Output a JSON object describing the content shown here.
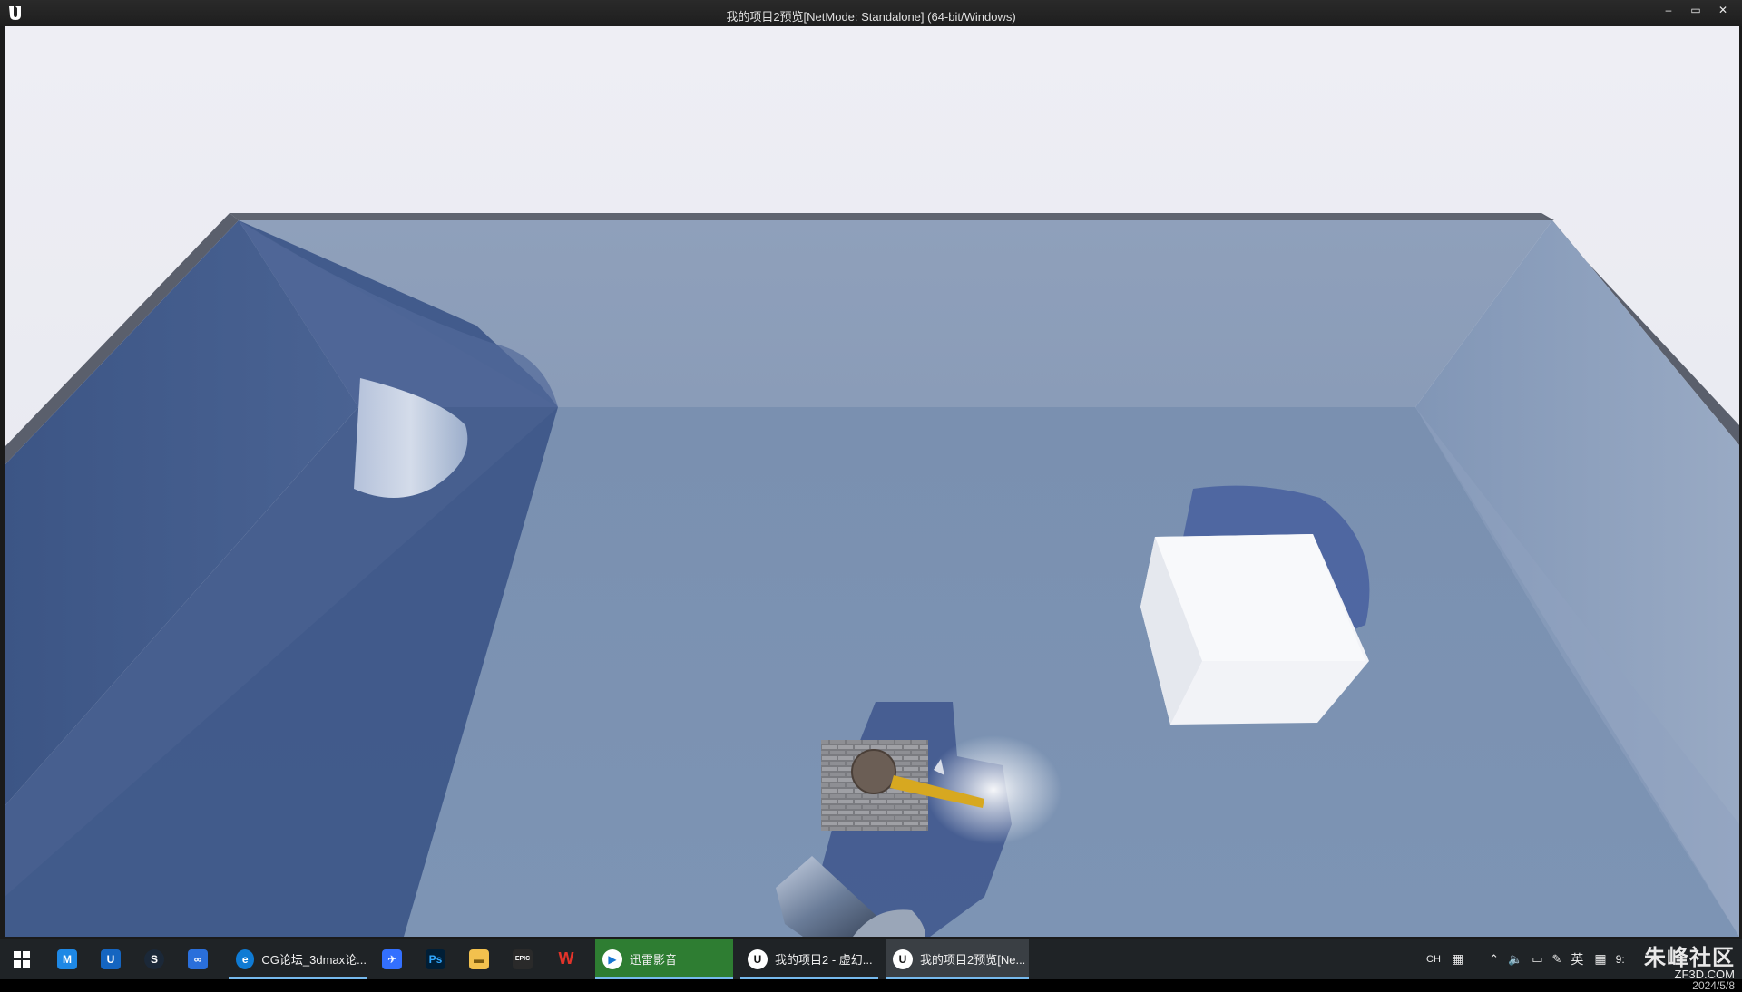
{
  "window": {
    "title": "我的项目2预览[NetMode: Standalone]  (64-bit/Windows)",
    "controls": {
      "minimize": "–",
      "maximize": "▭",
      "close": "✕"
    }
  },
  "taskbar": {
    "start_icon": "windows-start-icon",
    "pinned": [
      {
        "name": "app-blue-m-icon",
        "glyph": "M",
        "color": "#1e88e5"
      },
      {
        "name": "app-u-icon",
        "glyph": "U",
        "color": "#1565c0"
      },
      {
        "name": "steam-icon",
        "glyph": "S",
        "color": "#1b2838"
      },
      {
        "name": "baidu-netdisk-icon",
        "glyph": "∞",
        "color": "#2a6fdb"
      }
    ],
    "tasks": [
      {
        "label": "CG论坛_3dmax论...",
        "icon": "edge-browser-icon",
        "active": true
      },
      {
        "label": "迅雷影音",
        "icon": "xunlei-player-icon",
        "active": true
      },
      {
        "label": "我的项目2 - 虚幻...",
        "icon": "unreal-engine-icon",
        "active": true
      },
      {
        "label": "我的项目2预览[Ne...",
        "icon": "unreal-engine-icon",
        "active": true
      }
    ],
    "more_pinned": [
      {
        "name": "feishu-icon",
        "glyph": "✈",
        "color": "#3370ff"
      },
      {
        "name": "photoshop-icon",
        "glyph": "Ps",
        "color": "#001e36"
      },
      {
        "name": "file-explorer-icon",
        "glyph": "▬",
        "color": "#f2c14e"
      },
      {
        "name": "epic-games-icon",
        "glyph": "EPIC",
        "color": "#2a2a2a"
      },
      {
        "name": "wps-icon",
        "glyph": "W",
        "color": "#d7261e"
      }
    ],
    "tray": {
      "lang_code": "CH",
      "ime": "英",
      "time": "9:",
      "date": "2024/5/8"
    }
  },
  "watermark": {
    "main": "朱峰社区",
    "sub": "ZF3D.COM"
  },
  "colors": {
    "sky": "#e8e9f0",
    "floor": "#7d93b2",
    "wall_dark": "#405a8a",
    "accent_underline": "#76b9ed"
  }
}
